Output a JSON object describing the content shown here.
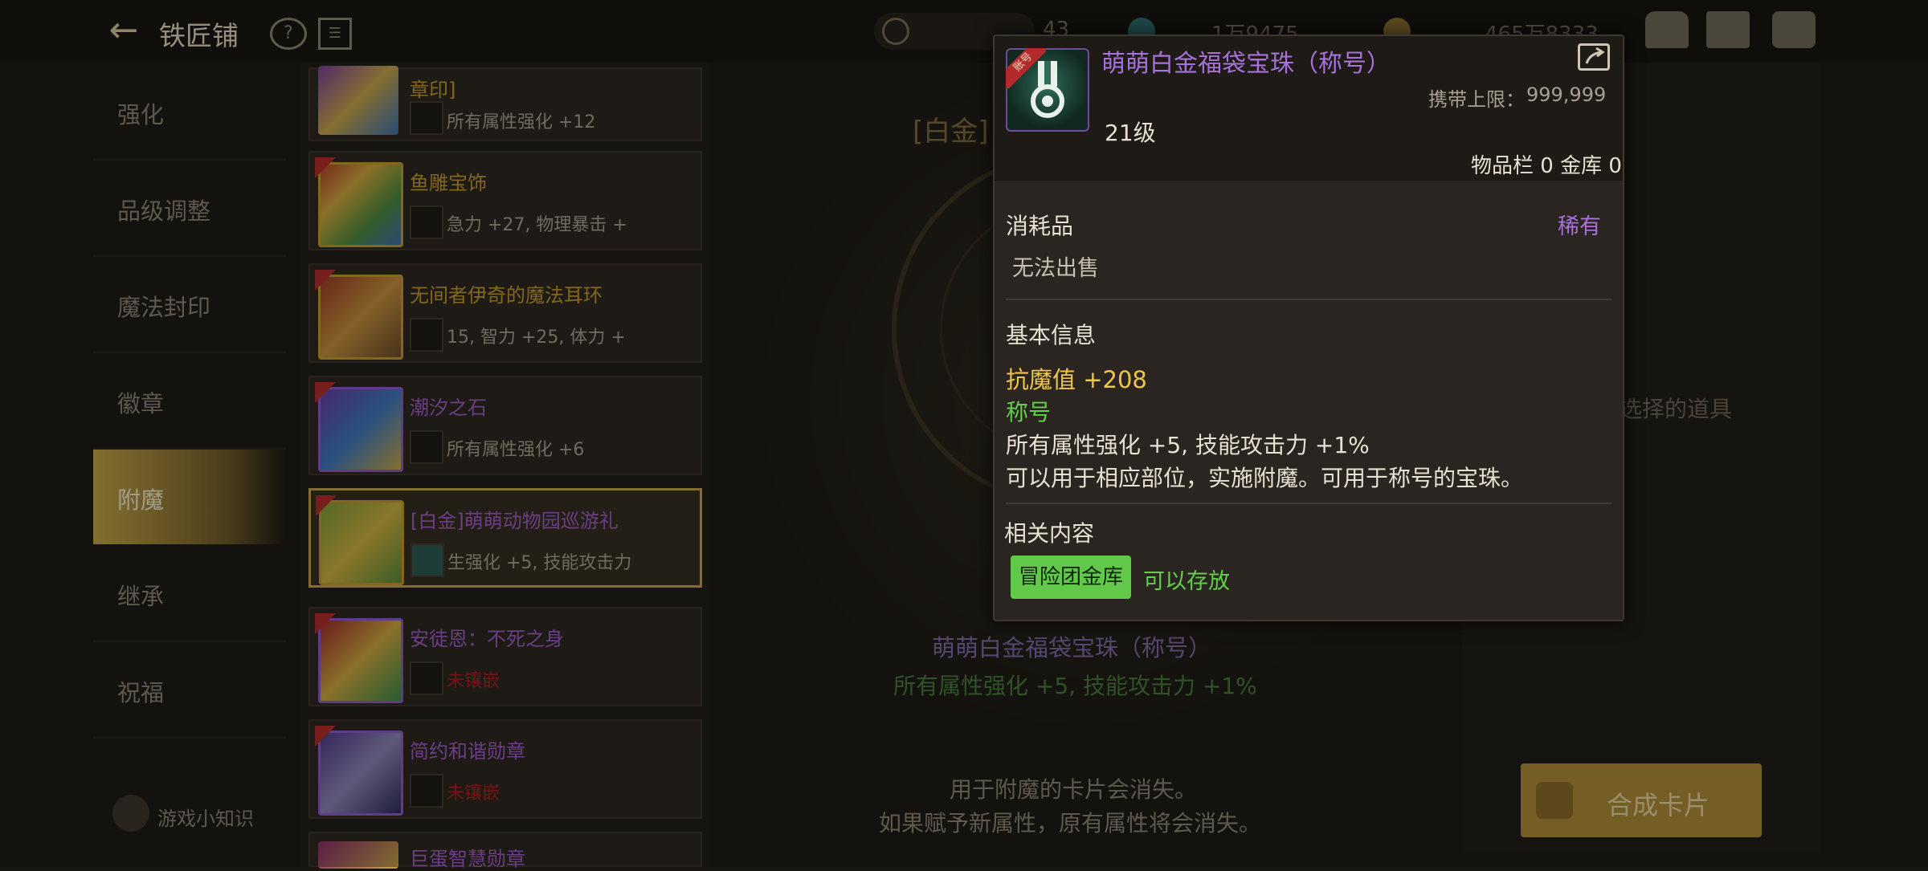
{
  "header": {
    "title": "铁匠铺",
    "resources": [
      {
        "value": "43",
        "icon": "blue-gem-icon"
      },
      {
        "value": "1万9475",
        "icon": "gold-coin-icon"
      },
      {
        "value": "465万8333",
        "icon": "gold-pouch-icon"
      }
    ]
  },
  "nav": {
    "items": [
      {
        "label": "强化",
        "active": false
      },
      {
        "label": "品级调整",
        "active": false
      },
      {
        "label": "魔法封印",
        "active": false
      },
      {
        "label": "徽章",
        "active": false
      },
      {
        "label": "附魔",
        "active": true
      },
      {
        "label": "继承",
        "active": false
      },
      {
        "label": "祝福",
        "active": false
      }
    ],
    "tip": "游戏小知识"
  },
  "list": {
    "cards": [
      {
        "name": "章印]",
        "stat": "所有属性强化 +12",
        "name_color": "#c59a2c"
      },
      {
        "name": "鱼雕宝饰",
        "stat": "急力 +27, 物理暴击 +",
        "name_color": "#c59a2c"
      },
      {
        "name": "无间者伊奇的魔法耳环",
        "stat": "15, 智力 +25, 体力 +",
        "name_color": "#c59a2c"
      },
      {
        "name": "潮汐之石",
        "stat": "所有属性强化 +6",
        "name_color": "#a059c8"
      },
      {
        "name": "[白金]萌萌动物园巡游礼",
        "stat": "生强化 +5, 技能攻击力",
        "name_color": "#a059c8"
      },
      {
        "name": "安徒恩：不死之身",
        "stat": "未镶嵌",
        "name_color": "#a059c8"
      },
      {
        "name": "简约和谐勋章",
        "stat": "未镶嵌",
        "name_color": "#a059c8"
      },
      {
        "name": "巨蛋智慧勋章",
        "stat": "",
        "name_color": "#a059c8"
      }
    ]
  },
  "center": {
    "slot_label": "[白金]",
    "result_name": "萌萌白金福袋宝珠（称号）",
    "result_stat": "所有属性强化 +5, 技能攻击力 +1%",
    "note1": "用于附魔的卡片会消失。",
    "note2": "如果赋予新属性，原有属性将会消失。"
  },
  "right": {
    "hint": "没有可以选择的道具",
    "craft_label": "合成卡片"
  },
  "tooltip": {
    "name": "萌萌白金福袋宝珠（称号）",
    "account_badge": "账号",
    "limit_label": "携带上限：",
    "limit_value": "999,999",
    "level": "21级",
    "stock": "物品栏 0 金库 0",
    "type": "消耗品",
    "rarity": "稀有",
    "no_sell": "无法出售",
    "basic_info": "基本信息",
    "resist": "抗魔值 +208",
    "title_tag": "称号",
    "stats": "所有属性强化 +5, 技能攻击力 +1%",
    "desc": "可以用于相应部位，实施附魔。可用于称号的宝珠。",
    "related": "相关内容",
    "tag": "冒险团金库",
    "storable": "可以存放"
  }
}
